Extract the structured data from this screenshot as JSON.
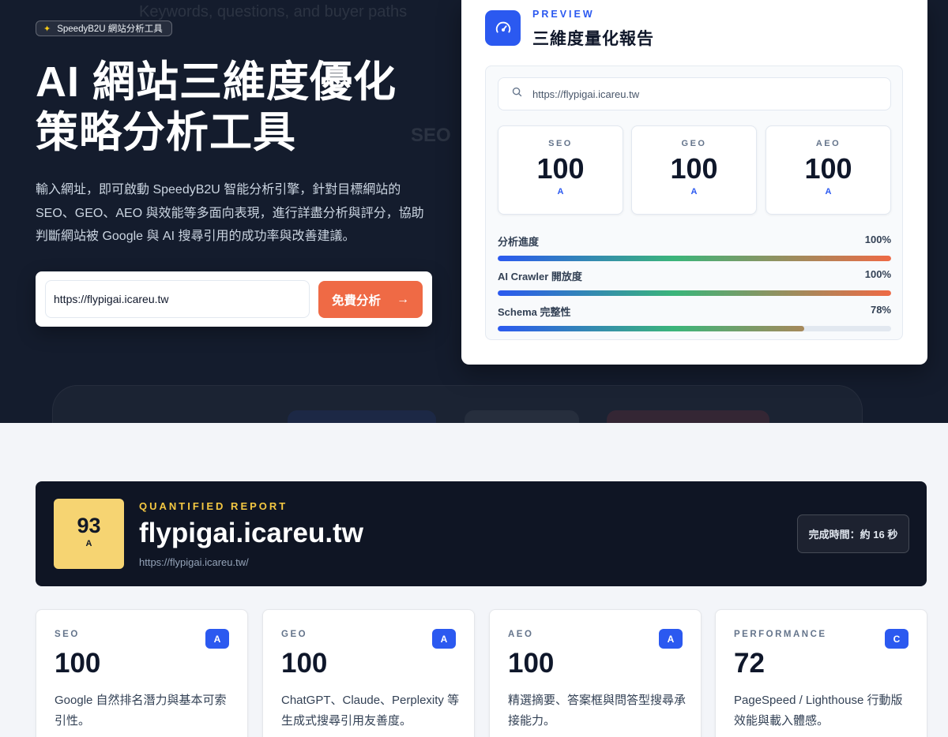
{
  "hero": {
    "background_keywords": "Keywords, questions, and buyer paths",
    "background_seo": "SEO",
    "badge": "SpeedyB2U 網站分析工具",
    "title_line1": "AI 網站三維度優化",
    "title_line2": "策略分析工具",
    "description": "輸入網址，即可啟動 SpeedyB2U 智能分析引擎，針對目標網站的 SEO、GEO、AEO 與效能等多面向表現，進行詳盡分析與評分，協助判斷網站被 Google 與 AI 搜尋引用的成功率與改善建議。",
    "url_input_value": "https://flypigai.icareu.tw",
    "submit_label": "免費分析",
    "accent_color": "#ef6a45"
  },
  "preview": {
    "kicker": "PREVIEW",
    "title": "三維度量化報告",
    "icon": "gauge-icon",
    "search_text": "https://flypigai.icareu.tw",
    "scores": [
      {
        "label": "SEO",
        "value": "100",
        "grade": "A"
      },
      {
        "label": "GEO",
        "value": "100",
        "grade": "A"
      },
      {
        "label": "AEO",
        "value": "100",
        "grade": "A"
      }
    ],
    "bars": [
      {
        "label": "分析進度",
        "percent_text": "100%",
        "value": 1.0
      },
      {
        "label": "AI Crawler 開放度",
        "percent_text": "100%",
        "value": 1.0
      },
      {
        "label": "Schema 完整性",
        "percent_text": "78%",
        "value": 0.78
      }
    ]
  },
  "report": {
    "score": "93",
    "grade": "A",
    "kicker": "QUANTIFIED REPORT",
    "domain": "flypigai.icareu.tw",
    "url": "https://flypigai.icareu.tw/",
    "completion_time": "完成時間：約 16 秒",
    "score_color": "#f6d472"
  },
  "metrics": [
    {
      "label": "SEO",
      "grade": "A",
      "value": "100",
      "description": "Google 自然排名潛力與基本可索引性。"
    },
    {
      "label": "GEO",
      "grade": "A",
      "value": "100",
      "description": "ChatGPT、Claude、Perplexity 等生成式搜尋引用友善度。"
    },
    {
      "label": "AEO",
      "grade": "A",
      "value": "100",
      "description": "精選摘要、答案框與問答型搜尋承接能力。"
    },
    {
      "label": "PERFORMANCE",
      "grade": "C",
      "value": "72",
      "description": "PageSpeed / Lighthouse 行動版效能與載入體感。"
    }
  ]
}
